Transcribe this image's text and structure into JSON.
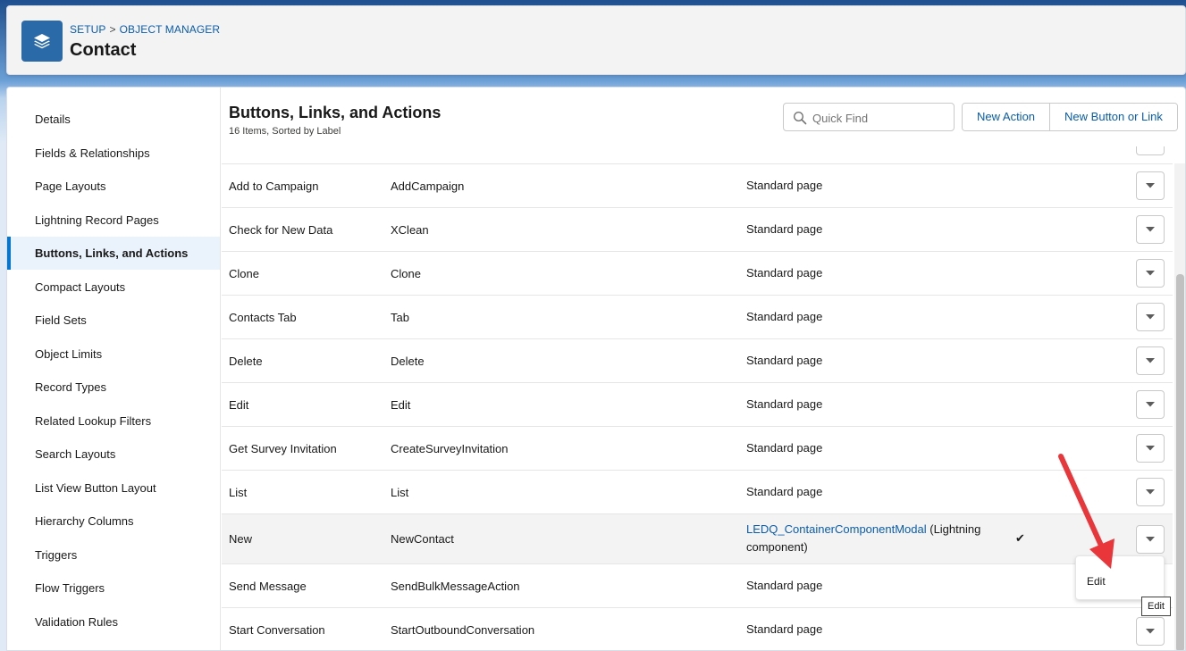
{
  "header": {
    "crumb_setup": "SETUP",
    "crumb_sep": ">",
    "crumb_object_manager": "OBJECT MANAGER",
    "title": "Contact",
    "icon": "layers-icon"
  },
  "sidebar": {
    "items": [
      {
        "label": "Details"
      },
      {
        "label": "Fields & Relationships"
      },
      {
        "label": "Page Layouts"
      },
      {
        "label": "Lightning Record Pages"
      },
      {
        "label": "Buttons, Links, and Actions"
      },
      {
        "label": "Compact Layouts"
      },
      {
        "label": "Field Sets"
      },
      {
        "label": "Object Limits"
      },
      {
        "label": "Record Types"
      },
      {
        "label": "Related Lookup Filters"
      },
      {
        "label": "Search Layouts"
      },
      {
        "label": "List View Button Layout"
      },
      {
        "label": "Hierarchy Columns"
      },
      {
        "label": "Triggers"
      },
      {
        "label": "Flow Triggers"
      },
      {
        "label": "Validation Rules"
      }
    ],
    "active": "Buttons, Links, and Actions"
  },
  "section": {
    "title": "Buttons, Links, and Actions",
    "subtitle": "16 Items, Sorted by Label",
    "quick_find_placeholder": "Quick Find",
    "new_action_label": "New Action",
    "new_button_label": "New Button or Link"
  },
  "rows": [
    {
      "label": "Add to Campaign",
      "name": "AddCampaign",
      "override": "Standard page"
    },
    {
      "label": "Check for New Data",
      "name": "XClean",
      "override": "Standard page"
    },
    {
      "label": "Clone",
      "name": "Clone",
      "override": "Standard page"
    },
    {
      "label": "Contacts Tab",
      "name": "Tab",
      "override": "Standard page"
    },
    {
      "label": "Delete",
      "name": "Delete",
      "override": "Standard page"
    },
    {
      "label": "Edit",
      "name": "Edit",
      "override": "Standard page"
    },
    {
      "label": "Get Survey Invitation",
      "name": "CreateSurveyInvitation",
      "override": "Standard page"
    },
    {
      "label": "List",
      "name": "List",
      "override": "Standard page"
    },
    {
      "label": "New",
      "name": "NewContact",
      "override_link": "LEDQ_ContainerComponentModal",
      "override_suffix": " (Lightning component)",
      "check": "✔"
    },
    {
      "label": "Send Message",
      "name": "SendBulkMessageAction",
      "override": "Standard page"
    },
    {
      "label": "Start Conversation",
      "name": "StartOutboundConversation",
      "override": "Standard page"
    }
  ],
  "dropdown": {
    "item": "Edit"
  },
  "tooltip": "Edit",
  "colors": {
    "accent": "#0176d3",
    "link": "#0b5cab",
    "annotation_arrow": "#e8363b"
  }
}
